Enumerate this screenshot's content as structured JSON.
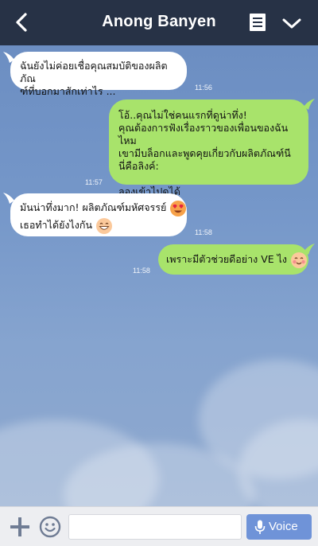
{
  "header": {
    "title": "Anong Banyen",
    "icons": {
      "back": "back-arrow-icon",
      "notes": "notes-icon",
      "menu": "chevron-down-icon"
    }
  },
  "messages": [
    {
      "direction": "incoming",
      "text": "ฉันยังไม่ค่อยเชื่อคุณสมบัติของผลิตภัณ\nฑ์ที่บอกมาสักเท่าไร ...",
      "time": "11:56"
    },
    {
      "direction": "outgoing",
      "text": "โอ้..คุณไม่ใช่คนแรกที่ดูน่าทึ่ง!\nคุณต้องการฟังเรื่องราวของเพื่อนของฉันไหม\nเขามีบล็อกและพูดคุยเกี่ยวกับผลิตภัณฑ์นี\nนี่คือลิงค์:\n\nลองเข้าไปดูได้",
      "time": "11:57"
    },
    {
      "direction": "incoming",
      "line1": "มันน่าทึ่งมาก! ผลิตภัณฑ์มหัศจรรย์",
      "line2": "เธอทำได้ยังไงกัน",
      "emojis": [
        "heart-eyes-emoji",
        "grinning-emoji"
      ],
      "time": "11:58"
    },
    {
      "direction": "outgoing",
      "text": "เพราะมีตัวช่วยดีอย่าง VE ไง",
      "emojis": [
        "blushing-emoji"
      ],
      "time": "11:58"
    }
  ],
  "input_bar": {
    "message_value": "",
    "message_placeholder": "",
    "voice_label": "Voice",
    "icons": {
      "add": "plus-icon",
      "sticker": "smiley-icon",
      "mic": "mic-icon"
    }
  },
  "colors": {
    "header_bg": "#273246",
    "outgoing_bubble": "#a8e36b",
    "incoming_bubble": "#ffffff",
    "voice_button": "#6f93d8",
    "chat_background": "#7597c9"
  }
}
